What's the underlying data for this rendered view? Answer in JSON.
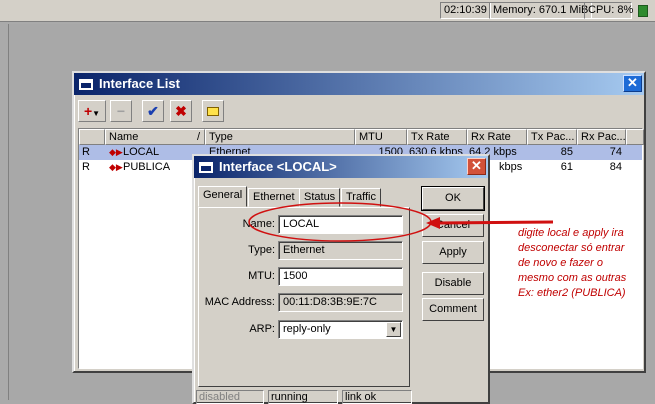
{
  "statusbar": {
    "time": "02:10:39",
    "memory": "Memory: 670.1 MiB",
    "cpu_label": "CPU:",
    "cpu_value": "8%"
  },
  "interface_list": {
    "title": "Interface List",
    "close_glyph": "✕",
    "toolbar": {
      "add_glyph": "+",
      "remove_glyph": "−",
      "enable_glyph": "✔",
      "disable_glyph": "✖",
      "comment_glyph": ""
    },
    "columns": [
      "Name",
      "Type",
      "MTU",
      "Tx Rate",
      "Rx Rate",
      "Tx Pac...",
      "Rx Pac..."
    ],
    "sort_glyph": "/",
    "rows": [
      {
        "flag": "R",
        "name": "LOCAL",
        "type": "Ethernet",
        "mtu": "1500",
        "tx_rate": "630.6 kbps",
        "rx_rate": "64.2 kbps",
        "tx_pkts": "85",
        "rx_pkts": "74"
      },
      {
        "flag": "R",
        "name": "PUBLICA",
        "type": "",
        "mtu": "",
        "tx_rate": "",
        "rx_rate": "kbps",
        "tx_pkts": "61",
        "rx_pkts": "84"
      }
    ]
  },
  "dialog": {
    "title": "Interface <LOCAL>",
    "close_glyph": "✕",
    "tabs": [
      "General",
      "Ethernet",
      "Status",
      "Traffic"
    ],
    "fields": {
      "name_label": "Name:",
      "name_value": "LOCAL",
      "type_label": "Type:",
      "type_value": "Ethernet",
      "mtu_label": "MTU:",
      "mtu_value": "1500",
      "mac_label": "MAC Address:",
      "mac_value": "00:11:D8:3B:9E:7C",
      "arp_label": "ARP:",
      "arp_value": "reply-only",
      "arp_arrow": "▼"
    },
    "buttons": {
      "ok": "OK",
      "cancel": "Cancel",
      "apply": "Apply",
      "disable": "Disable",
      "comment": "Comment"
    },
    "status": {
      "disabled": "disabled",
      "running": "running",
      "link": "link ok"
    }
  },
  "annotation": {
    "lines": [
      "digite local e apply ira",
      "desconectar só entrar",
      "de novo e fazer  o",
      "mesmo com as outras",
      "Ex: ether2 (PUBLICA)"
    ],
    "color": "#c00000"
  },
  "colors": {
    "titlebar": "#0a246a",
    "selected_row": "#aebde6",
    "annotation": "#c00000"
  }
}
